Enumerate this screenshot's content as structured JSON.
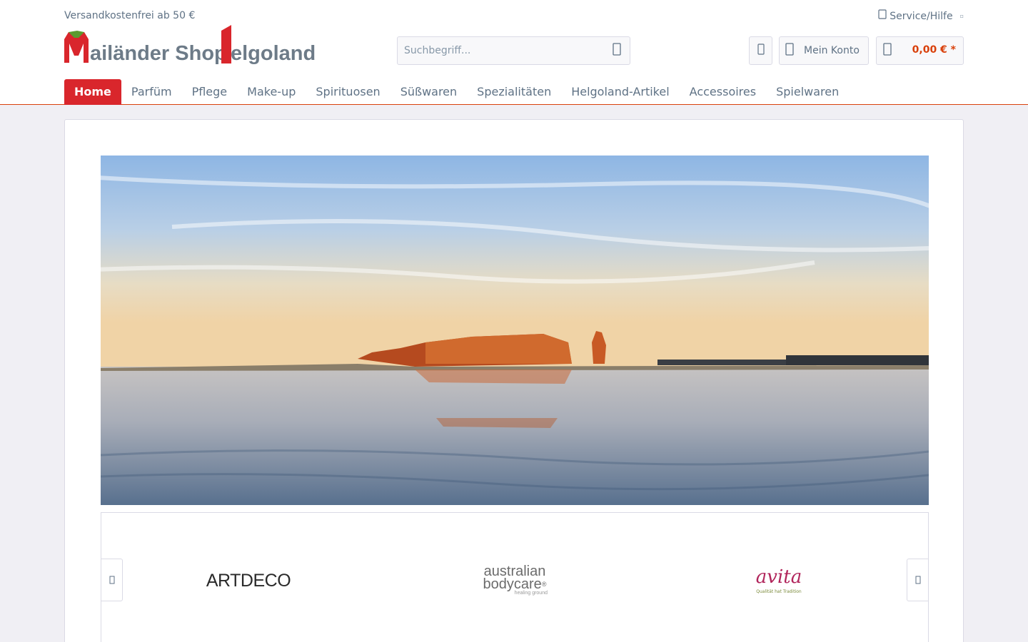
{
  "topbar": {
    "shipping_note": "Versandkostenfrei ab 50 €",
    "service_label": "Service/Hilfe"
  },
  "logo": {
    "text_left": "ailänder Shop",
    "text_right": "elgoland",
    "letter_m": "M",
    "colors": {
      "red": "#d9262c",
      "green": "#5a9b2f",
      "grey": "#6d7b88"
    }
  },
  "search": {
    "placeholder": "Suchbegriff..."
  },
  "header_actions": {
    "account_label": "Mein Konto",
    "cart_total": "0,00 € *"
  },
  "nav": {
    "items": [
      {
        "label": "Home",
        "active": true
      },
      {
        "label": "Parfüm"
      },
      {
        "label": "Pflege"
      },
      {
        "label": "Make-up"
      },
      {
        "label": "Spirituosen"
      },
      {
        "label": "Süßwaren"
      },
      {
        "label": "Spezialitäten"
      },
      {
        "label": "Helgoland-Artikel"
      },
      {
        "label": "Accessoires"
      },
      {
        "label": "Spielwaren"
      }
    ]
  },
  "brands": {
    "artdeco": "ARTDECO",
    "australian_line1": "australian",
    "australian_line2": "bodycare",
    "australian_reg": "®",
    "australian_tagline": "healing ground",
    "avita_name": "avita",
    "avita_tagline": "Qualität hat Tradition"
  },
  "colors": {
    "accent_red": "#d9262c",
    "text_grey": "#5f7285",
    "border": "#dadae5",
    "page_bg": "#f0eff4"
  }
}
